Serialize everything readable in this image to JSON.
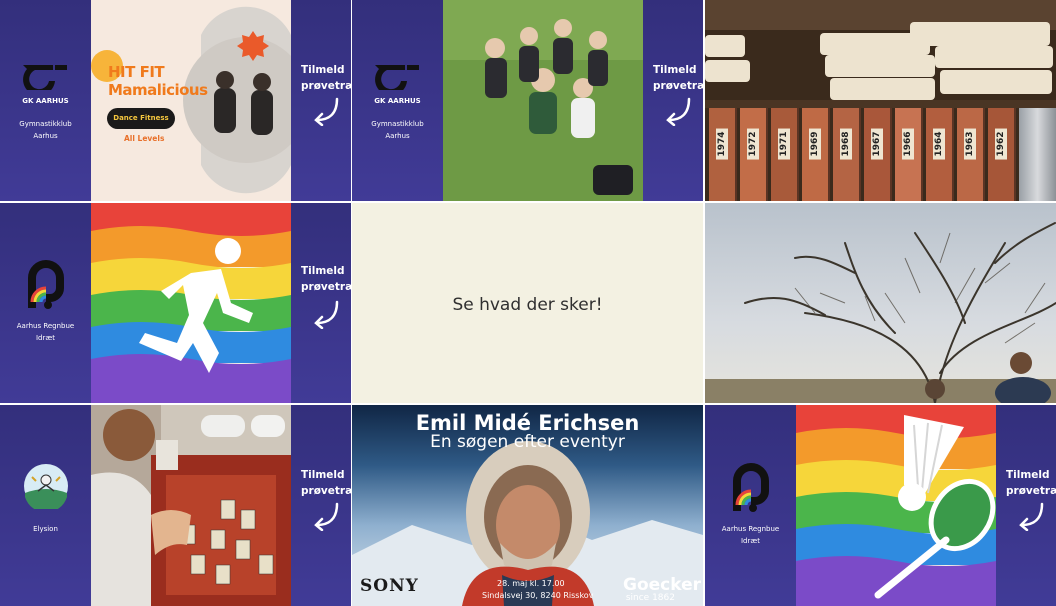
{
  "tiles": {
    "t1": {
      "club": {
        "logo_text": "GK AARHUS",
        "name_line1": "Gymnastikklub",
        "name_line2": "Aarhus"
      },
      "cta": {
        "line1": "Tilmeld",
        "line2": "prøvetræn"
      },
      "poster": {
        "title_line1": "HIT FIT",
        "title_line2": "Mamalicious",
        "pill": "Dance Fitness",
        "levels": "All Levels"
      }
    },
    "t2": {
      "club": {
        "logo_text": "GK AARHUS",
        "name_line1": "Gymnastikklub",
        "name_line2": "Aarhus"
      },
      "cta": {
        "line1": "Tilmeld",
        "line2": "prøvetræn"
      }
    },
    "t3": {
      "binder_labels": [
        "1974",
        "1972",
        "1971",
        "1969",
        "1968",
        "1967",
        "1966",
        "1964",
        "1963",
        "1962"
      ]
    },
    "t4": {
      "club": {
        "name_line1": "Aarhus Regnbue",
        "name_line2": "Idræt"
      },
      "cta": {
        "line1": "Tilmeld",
        "line2": "prøvetræn"
      }
    },
    "t5": {
      "message": "Se hvad der sker!"
    },
    "t7": {
      "club": {
        "name_line1": "Elysion"
      },
      "cta": {
        "line1": "Tilmeld",
        "line2": "prøvetræn"
      }
    },
    "t8": {
      "name": "Emil Midé Erichsen",
      "subtitle": "En søgen efter eventyr",
      "sponsor": "SONY",
      "date": "28. maj kl. 17.00",
      "address": "Sindalsvej 30, 8240 Risskov",
      "brand": "Goecker",
      "since": "since 1862"
    },
    "t9": {
      "club": {
        "name_line1": "Aarhus Regnbue",
        "name_line2": "Idræt"
      },
      "cta": {
        "line1": "Tilmeld",
        "line2": "prøvetræn"
      }
    }
  },
  "colors": {
    "promo_purple": "#3a3488",
    "rainbow": [
      "#e8433a",
      "#f39a2b",
      "#f6d63a",
      "#4bb54b",
      "#2f8be0",
      "#7b4bc8"
    ],
    "accent_orange": "#f07a1c"
  }
}
